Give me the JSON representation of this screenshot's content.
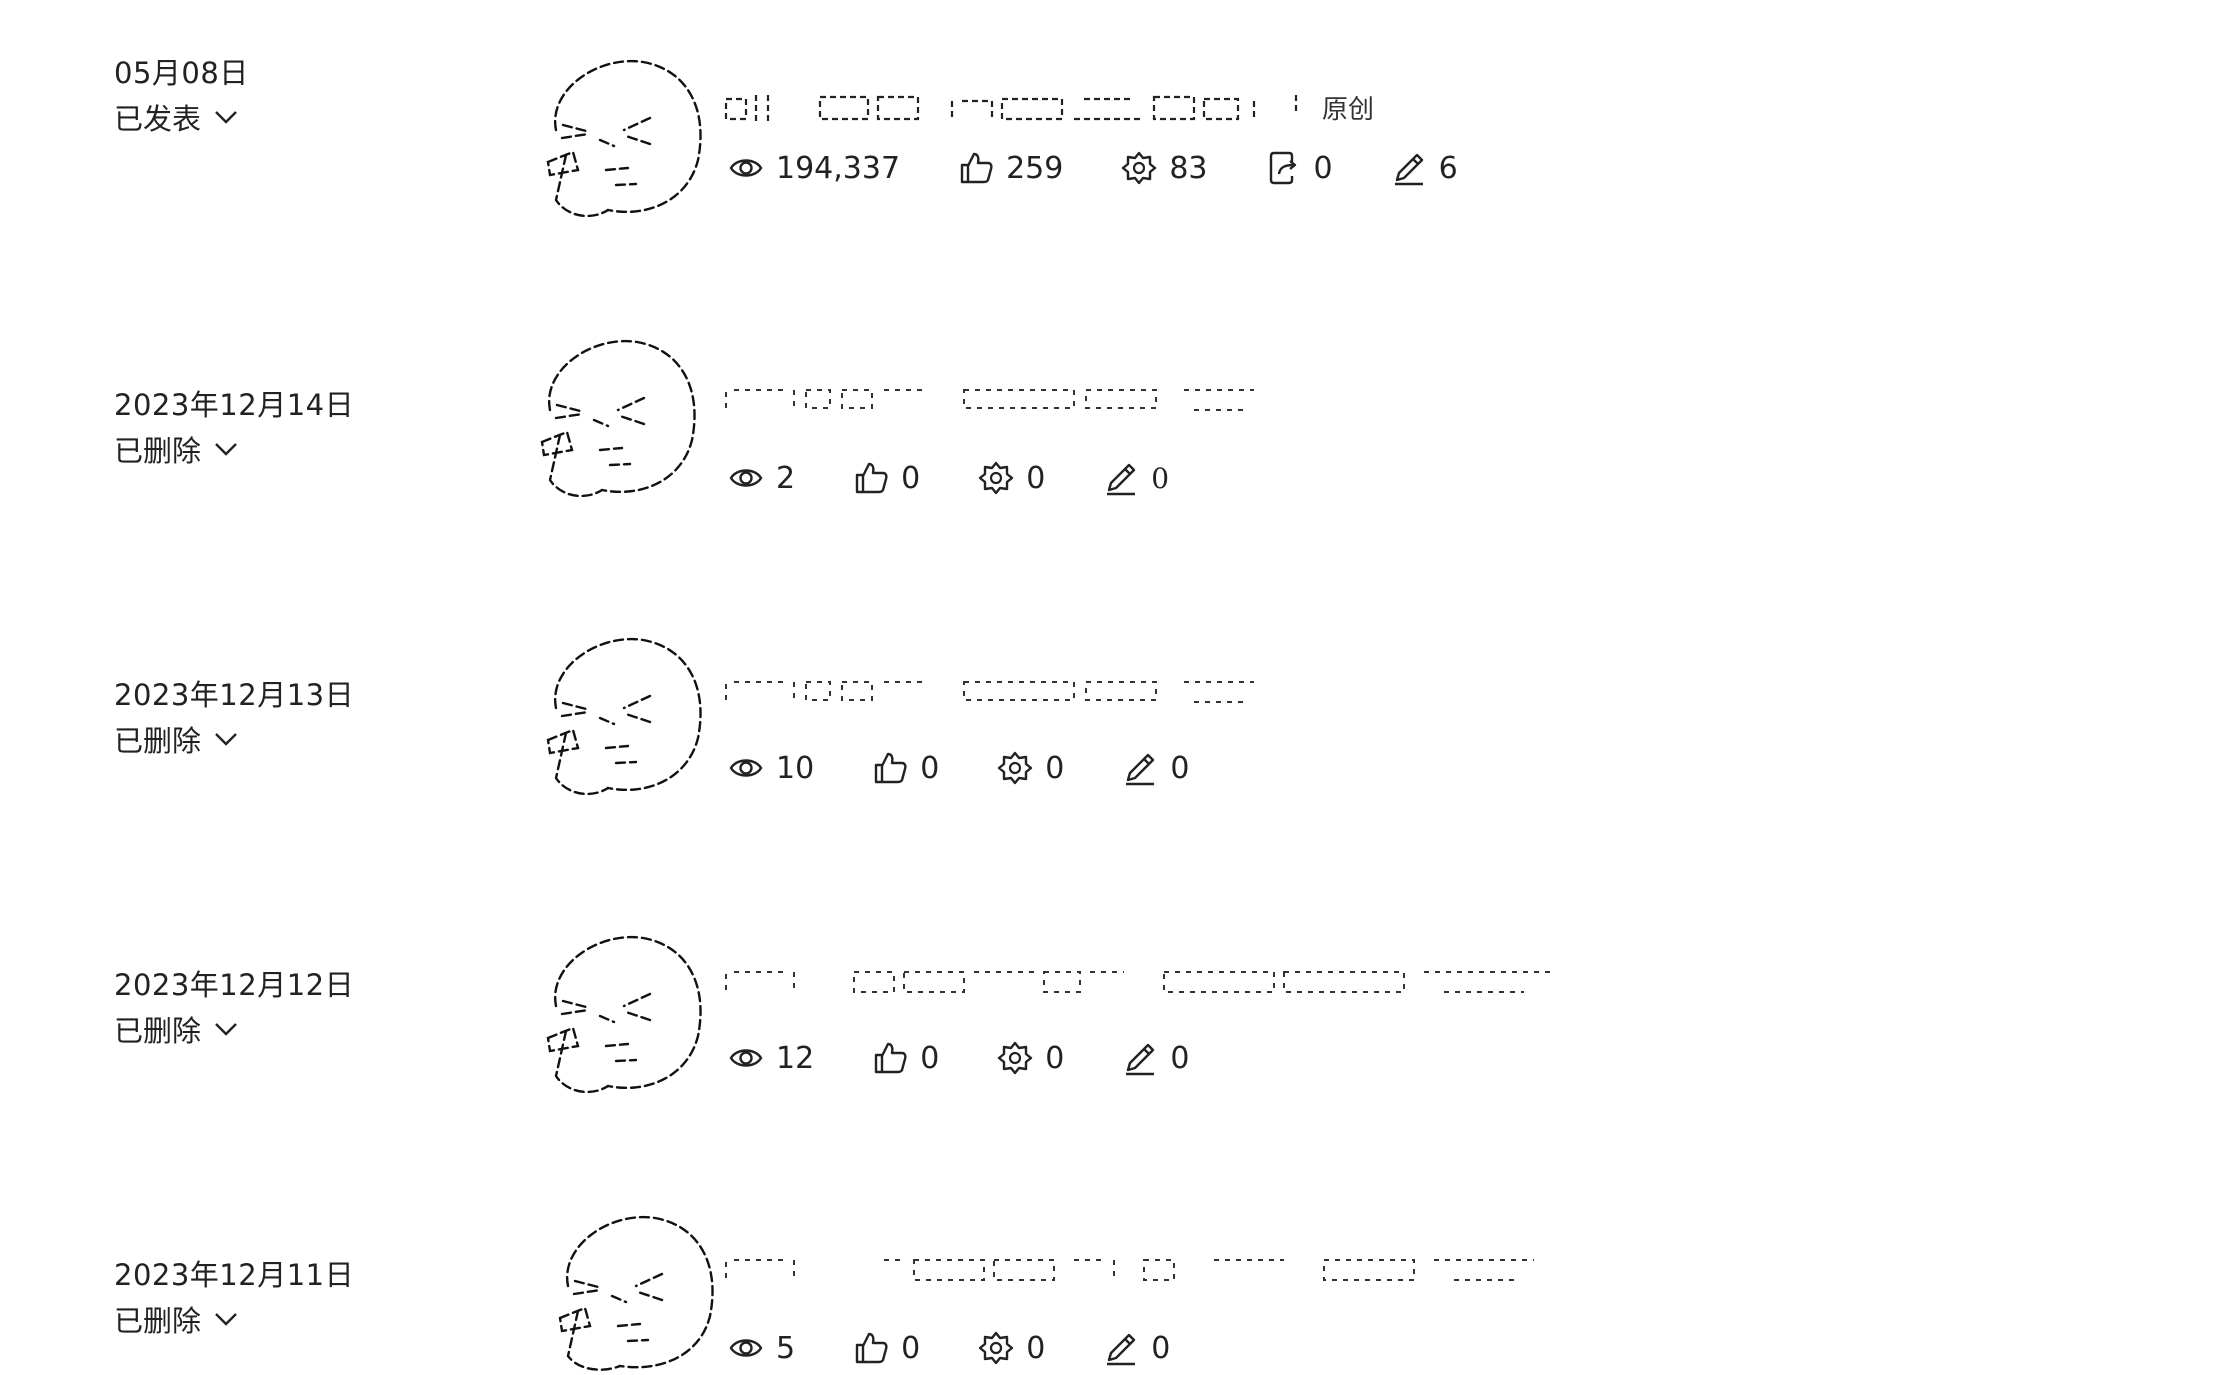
{
  "badge_label": "原创",
  "rows": [
    {
      "date": "05月08日",
      "status": "已发表",
      "stats": {
        "views": "194,337",
        "likes": "259",
        "favorites": "83",
        "shares": "0",
        "comments": "6"
      }
    },
    {
      "date": "2023年12月14日",
      "status": "已删除",
      "stats": {
        "views": "2",
        "likes": "0",
        "favorites": "0",
        "comments": "0"
      }
    },
    {
      "date": "2023年12月13日",
      "status": "已删除",
      "stats": {
        "views": "10",
        "likes": "0",
        "favorites": "0",
        "comments": "0"
      }
    },
    {
      "date": "2023年12月12日",
      "status": "已删除",
      "stats": {
        "views": "12",
        "likes": "0",
        "favorites": "0",
        "comments": "0"
      }
    },
    {
      "date": "2023年12月11日",
      "status": "已删除",
      "stats": {
        "views": "5",
        "likes": "0",
        "favorites": "0",
        "comments": "0"
      }
    }
  ],
  "icons": {
    "views": "eye-icon",
    "likes": "thumbs-up-icon",
    "favorites": "gear-star-icon",
    "shares": "share-icon",
    "comments": "pen-icon",
    "status_toggle": "chevron-down-icon"
  }
}
